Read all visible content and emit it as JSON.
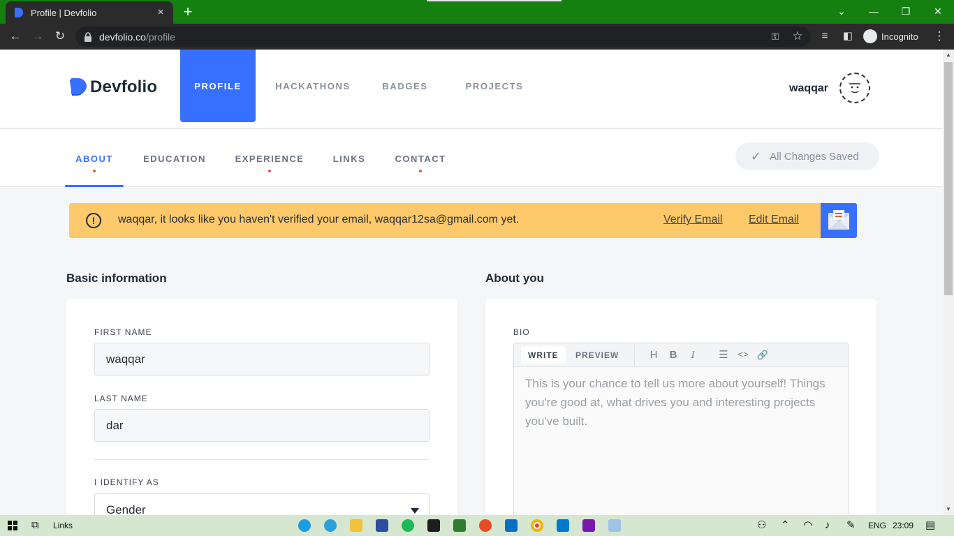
{
  "browser": {
    "tab_title": "Profile | Devfolio",
    "tab_close": "×",
    "new_tab": "+",
    "url_host": "devfolio.co",
    "url_path": "/profile",
    "incognito_label": "Incognito",
    "controls": {
      "tab_search": "⌄",
      "minimize": "—",
      "restore": "❐",
      "close": "✕"
    }
  },
  "header": {
    "logo_text": "Devfolio",
    "nav": [
      {
        "label": "PROFILE",
        "active": true
      },
      {
        "label": "HACKATHONS"
      },
      {
        "label": "BADGES"
      },
      {
        "label": "PROJECTS"
      }
    ],
    "username": "waqqar"
  },
  "subnav": {
    "tabs": [
      {
        "label": "ABOUT",
        "active": true,
        "dot": true
      },
      {
        "label": "EDUCATION"
      },
      {
        "label": "EXPERIENCE",
        "dot": true
      },
      {
        "label": "LINKS"
      },
      {
        "label": "CONTACT",
        "dot": true
      }
    ],
    "status": "All Changes Saved",
    "status_icon": "check-icon"
  },
  "banner": {
    "icon": "!",
    "message": "waqqar, it looks like you haven't verified your email, waqqar12sa@gmail.com yet.",
    "verify_link": "Verify Email",
    "edit_link": "Edit Email"
  },
  "basic_info": {
    "title": "Basic information",
    "first_name_label": "FIRST NAME",
    "first_name_value": "waqqar",
    "last_name_label": "LAST NAME",
    "last_name_value": "dar",
    "identify_label": "I IDENTIFY AS",
    "gender_value": "Gender"
  },
  "about": {
    "title": "About you",
    "bio_label": "BIO",
    "tab_write": "WRITE",
    "tab_preview": "PREVIEW",
    "tools": {
      "heading": "H",
      "bold": "B",
      "italic": "I",
      "list": "☰",
      "code": "<>",
      "link": "🔗"
    },
    "placeholder": "This is your chance to tell us more about yourself! Things you're good at, what drives you and interesting projects you've built."
  },
  "taskbar": {
    "links_label": "Links",
    "language": "ENG",
    "time": "23:09"
  },
  "colors": {
    "accent": "#3770ff",
    "tabstrip": "#138010",
    "banner": "#fdc96a",
    "dot": "#e8553a"
  }
}
